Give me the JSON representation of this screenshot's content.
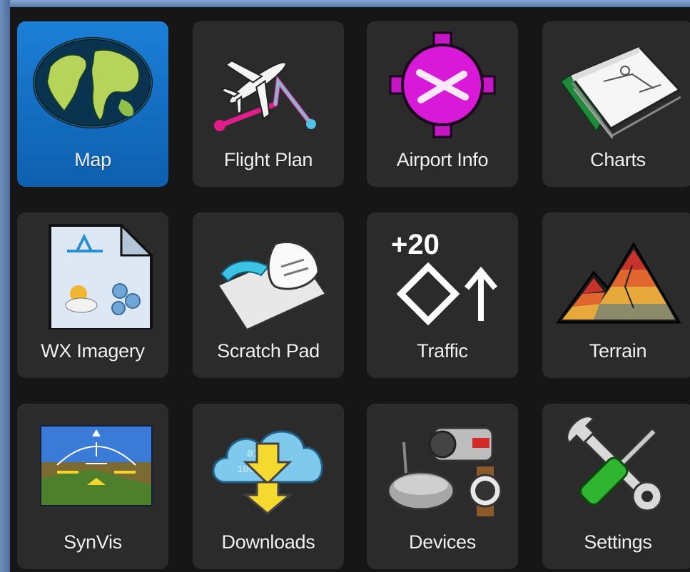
{
  "tiles": [
    {
      "label": "Map",
      "icon": "globe-map-icon",
      "active": true
    },
    {
      "label": "Flight Plan",
      "icon": "airplane-route-icon"
    },
    {
      "label": "Airport Info",
      "icon": "airport-symbol-icon"
    },
    {
      "label": "Charts",
      "icon": "chart-book-icon"
    },
    {
      "label": "WX Imagery",
      "icon": "weather-imagery-icon"
    },
    {
      "label": "Scratch Pad",
      "icon": "scratch-pad-icon"
    },
    {
      "label": "Traffic",
      "icon": "traffic-icon",
      "traffic_altitude": "+20"
    },
    {
      "label": "Terrain",
      "icon": "terrain-mountain-icon"
    },
    {
      "label": "SynVis",
      "icon": "synthetic-vision-icon"
    },
    {
      "label": "Downloads",
      "icon": "cloud-download-icon"
    },
    {
      "label": "Devices",
      "icon": "devices-icon"
    },
    {
      "label": "Settings",
      "icon": "wrench-screwdriver-icon"
    }
  ],
  "colors": {
    "active_tile": "#1474c8",
    "tile": "#2b2b2b",
    "background": "#161616"
  }
}
